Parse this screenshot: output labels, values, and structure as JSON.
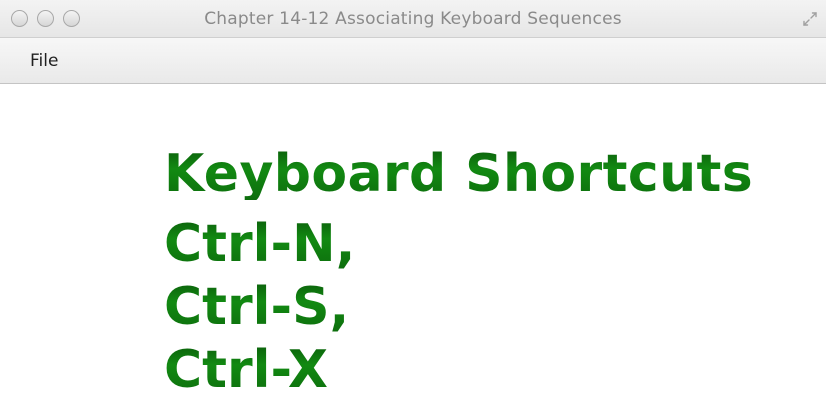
{
  "window": {
    "title": "Chapter 14-12 Associating Keyboard Sequences"
  },
  "menubar": {
    "items": [
      {
        "label": "File"
      }
    ]
  },
  "content": {
    "text_color": "#0f7a0f",
    "lines": [
      "Keyboard Shortcuts",
      "Ctrl-N,",
      "Ctrl-S,",
      "Ctrl-X"
    ]
  },
  "icons": {
    "traffic_lights": [
      "close-icon",
      "minimize-icon",
      "zoom-icon"
    ],
    "fullscreen": "fullscreen-arrows-icon"
  }
}
